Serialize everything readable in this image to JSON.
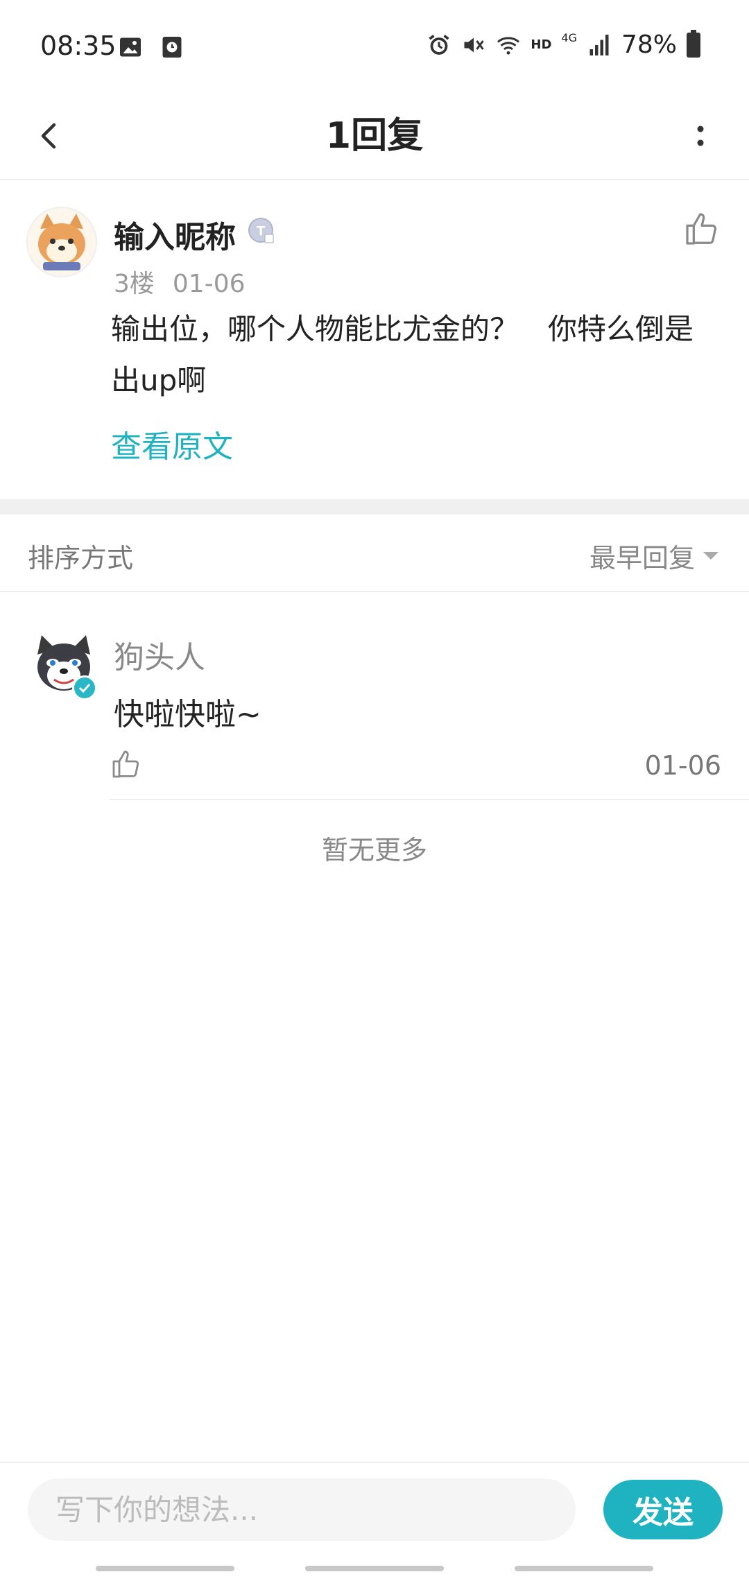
{
  "status_bar": {
    "time": "08:35",
    "network": "4G",
    "hd": "HD",
    "battery": "78%",
    "icons": [
      "image-icon",
      "clock-app-icon",
      "alarm-icon",
      "mute-icon",
      "wifi-icon",
      "signal-icon",
      "battery-icon"
    ]
  },
  "header": {
    "title": "1回复",
    "back_icon": "chevron-left-icon",
    "more_icon": "more-vertical-icon"
  },
  "post": {
    "nickname": "输入昵称",
    "floor": "3楼",
    "date": "01-06",
    "content": "输出位，哪个人物能比尤金的？　你特么倒是出up啊",
    "view_original": "查看原文"
  },
  "sort": {
    "label": "排序方式",
    "selected": "最早回复"
  },
  "replies": [
    {
      "name": "狗头人",
      "text": "快啦快啦~",
      "date": "01-06"
    }
  ],
  "no_more": "暂无更多",
  "composer": {
    "placeholder": "写下你的想法...",
    "send_label": "发送"
  },
  "colors": {
    "accent": "#1fb3c1",
    "text": "#222222",
    "muted": "#888888"
  }
}
